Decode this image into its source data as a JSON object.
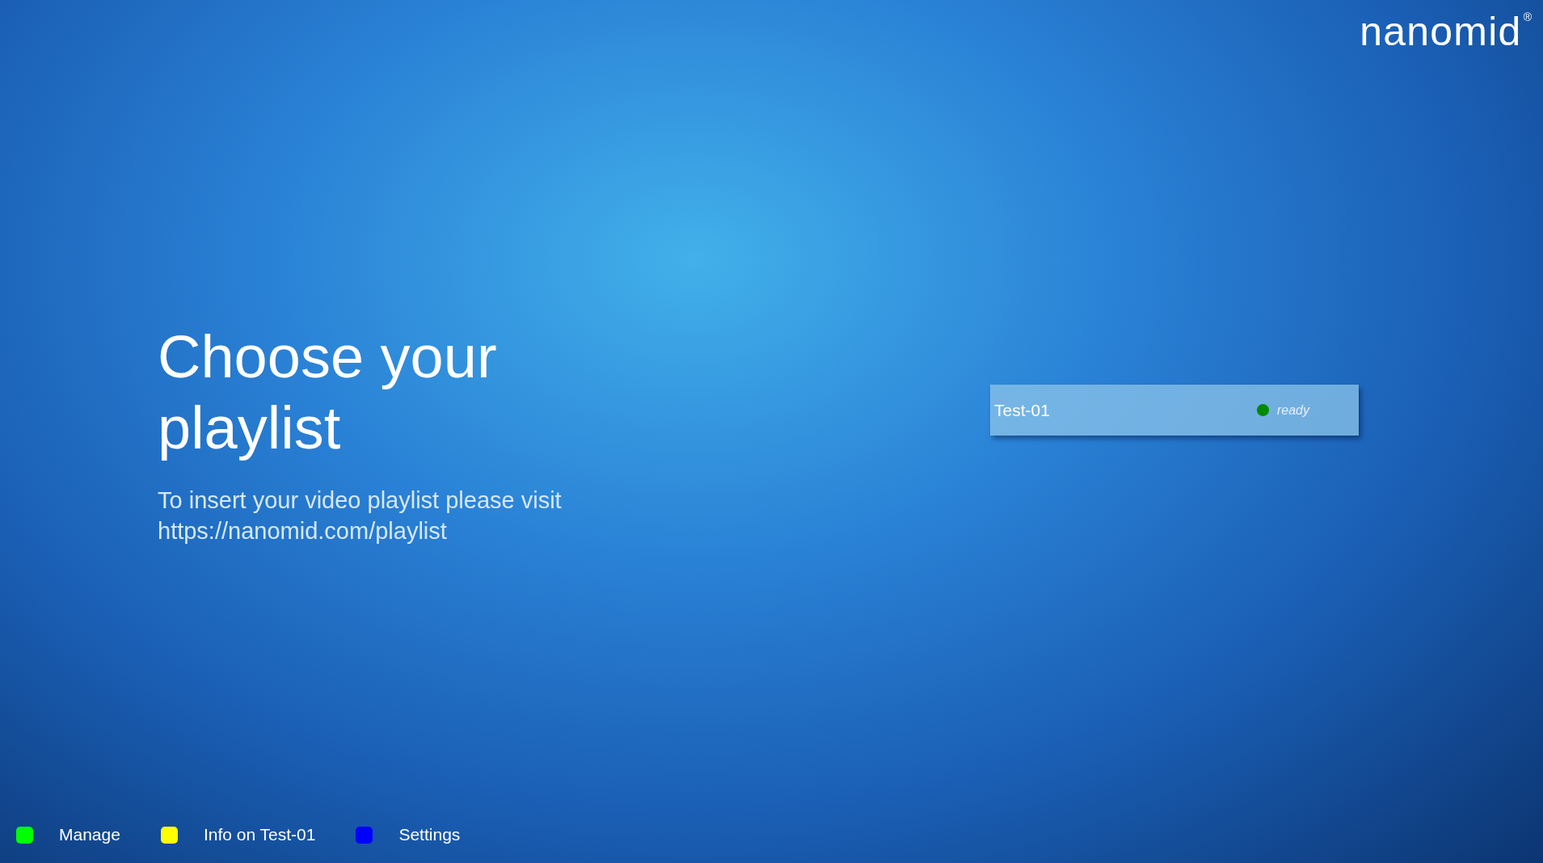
{
  "logo": {
    "text": "nanomid",
    "mark": "®"
  },
  "heading": "Choose your playlist",
  "instructions": [
    "To insert your video playlist please visit",
    "https://nanomid.com/playlist"
  ],
  "playlists": [
    {
      "name": "Test-01",
      "status": "ready",
      "color": "#008a00"
    }
  ],
  "legend": [
    {
      "label": "Manage",
      "color": "#00ff00"
    },
    {
      "label": "Info on Test-01",
      "color": "#ffff00"
    },
    {
      "label": "Settings",
      "color": "#0000ff"
    }
  ]
}
